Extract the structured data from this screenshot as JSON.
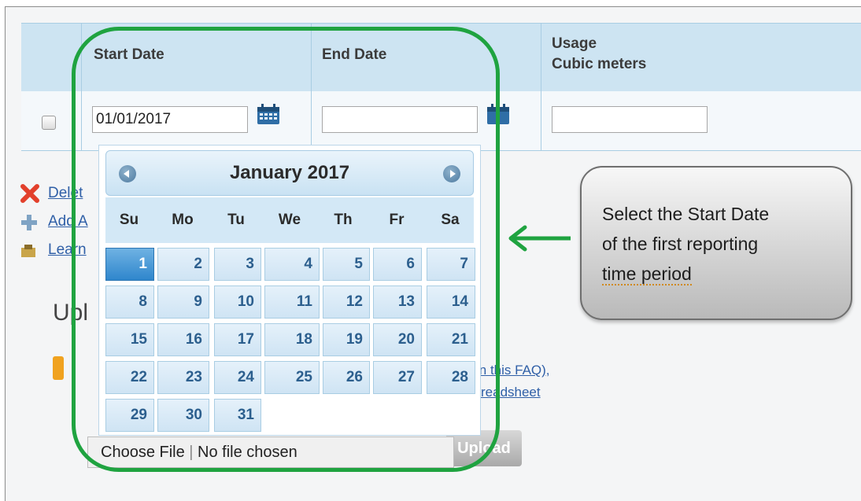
{
  "table": {
    "headers": {
      "start_date": "Start Date",
      "end_date": "End Date",
      "usage_line1": "Usage",
      "usage_line2": "Cubic meters"
    },
    "row": {
      "start_date_value": "01/01/2017",
      "end_date_value": "",
      "usage_value": ""
    }
  },
  "left_links": {
    "delete": "Delet",
    "add": "Add A",
    "learn": "Learn"
  },
  "upload_section": {
    "title": "Upl",
    "faq_link": "in this FAQ),",
    "spreadsheet_link": "readsheet",
    "choose_file": "Choose File",
    "no_file": "No file chosen",
    "upload_button": "Upload"
  },
  "datepicker": {
    "month_title": "January 2017",
    "weekdays": [
      "Su",
      "Mo",
      "Tu",
      "We",
      "Th",
      "Fr",
      "Sa"
    ],
    "selected_day": "1",
    "days": [
      "1",
      "2",
      "3",
      "4",
      "5",
      "6",
      "7",
      "8",
      "9",
      "10",
      "11",
      "12",
      "13",
      "14",
      "15",
      "16",
      "17",
      "18",
      "19",
      "20",
      "21",
      "22",
      "23",
      "24",
      "25",
      "26",
      "27",
      "28",
      "29",
      "30",
      "31"
    ]
  },
  "callout": {
    "line1": "Select the Start Date",
    "line2": "of the first reporting",
    "line3": "time period"
  },
  "colors": {
    "highlight_green": "#1fa340",
    "header_blue": "#cde4f2",
    "link_blue": "#2f5fa7"
  }
}
